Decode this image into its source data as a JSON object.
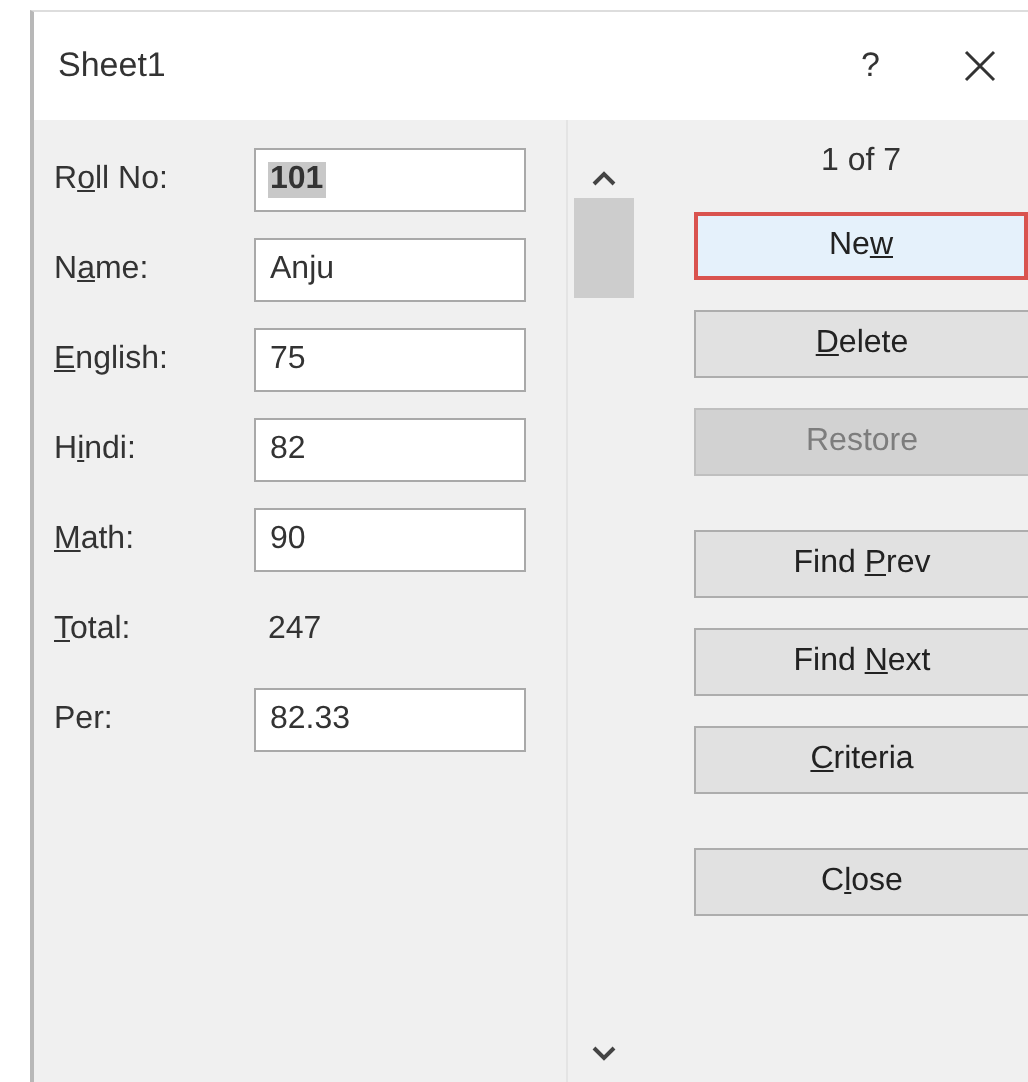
{
  "window": {
    "title": "Sheet1",
    "help": "?"
  },
  "fields": [
    {
      "kind": "input",
      "label": {
        "pre": "R",
        "key": "o",
        "post": "ll No:"
      },
      "value": "101",
      "text_selected": true
    },
    {
      "kind": "input",
      "label": {
        "pre": "N",
        "key": "a",
        "post": "me:"
      },
      "value": "Anju"
    },
    {
      "kind": "input",
      "label": {
        "key": "E",
        "post": "nglish:"
      },
      "value": "75"
    },
    {
      "kind": "input",
      "label": {
        "pre": "H",
        "key": "i",
        "post": "ndi:"
      },
      "value": "82"
    },
    {
      "kind": "input",
      "label": {
        "key": "M",
        "post": "ath:"
      },
      "value": "90"
    },
    {
      "kind": "text",
      "label": {
        "key": "T",
        "post": "otal:"
      },
      "value": "247"
    },
    {
      "kind": "input",
      "label": {
        "pre": "Per:"
      },
      "value": "82.33"
    }
  ],
  "record_counter": "1 of 7",
  "button_groups": [
    [
      {
        "label": {
          "pre": "Ne",
          "key": "w"
        },
        "focused": true,
        "disabled": false
      },
      {
        "label": {
          "key": "D",
          "post": "elete"
        },
        "focused": false,
        "disabled": false
      },
      {
        "label": {
          "pre": "Restore"
        },
        "focused": false,
        "disabled": true
      }
    ],
    [
      {
        "label": {
          "pre": "Find ",
          "key": "P",
          "post": "rev"
        },
        "focused": false,
        "disabled": false
      },
      {
        "label": {
          "pre": "Find ",
          "key": "N",
          "post": "ext"
        },
        "focused": false,
        "disabled": false
      },
      {
        "label": {
          "key": "C",
          "post": "riteria"
        },
        "focused": false,
        "disabled": false
      }
    ],
    [
      {
        "label": {
          "pre": "C",
          "key": "l",
          "post": "ose"
        },
        "focused": false,
        "disabled": false
      }
    ]
  ]
}
